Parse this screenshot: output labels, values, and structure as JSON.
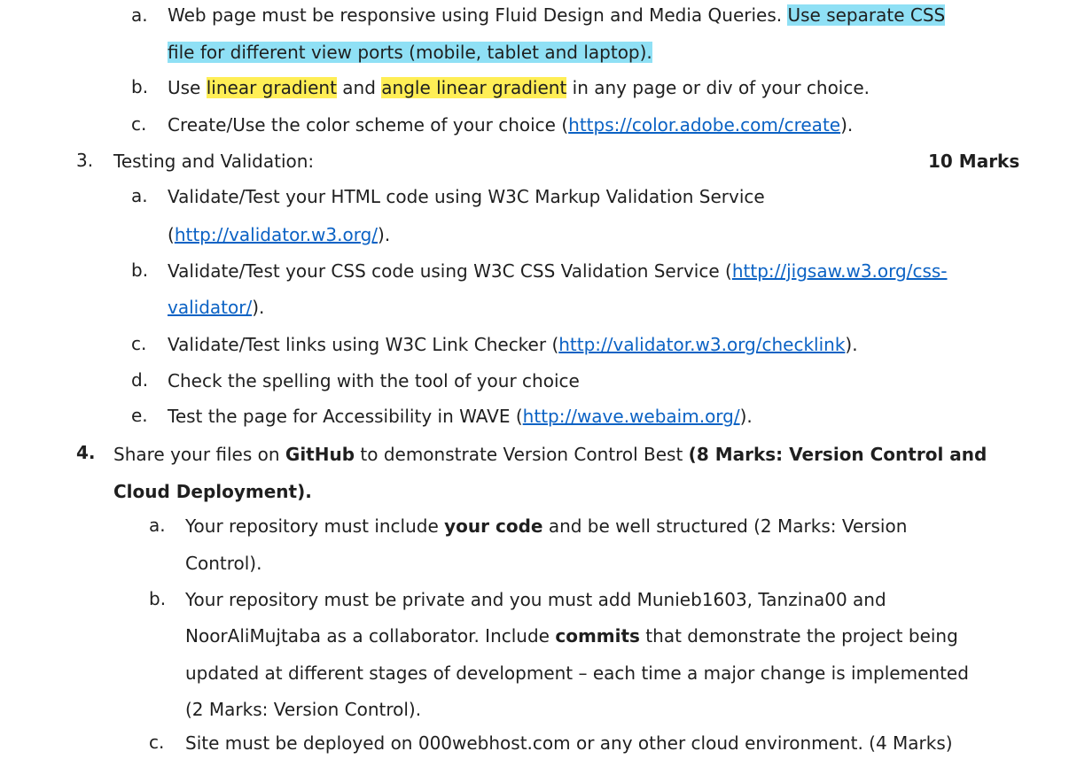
{
  "section2": {
    "a": {
      "label": "a.",
      "text1": "Web page must be responsive using Fluid Design and Media Queries. ",
      "highlight1": "Use separate CSS",
      "highlight2": "file for different view ports (mobile, tablet and laptop)."
    },
    "b": {
      "label": "b.",
      "text1": "Use ",
      "hl1": "linear gradient",
      "text2": " and ",
      "hl2": "angle linear gradient",
      "text3": " in any page or div of your choice."
    },
    "c": {
      "label": "c.",
      "text1": "Create/Use the color scheme of your choice (",
      "link": "https://color.adobe.com/create",
      "text2": ")."
    }
  },
  "section3": {
    "number": "3.",
    "title": "Testing and Validation:",
    "marks": "10 Marks",
    "a": {
      "label": "a.",
      "text1": "Validate/Test your HTML code using W3C Markup Validation Service",
      "open": "(",
      "link": "http://validator.w3.org/",
      "close": ")."
    },
    "b": {
      "label": "b.",
      "text1": "Validate/Test your CSS code using W3C CSS Validation Service (",
      "link1": "http://jigsaw.w3.org/css-",
      "link2": "validator/",
      "close": ")."
    },
    "c": {
      "label": "c.",
      "text1": "Validate/Test links using W3C Link Checker (",
      "link": "http://validator.w3.org/checklink",
      "close": ")."
    },
    "d": {
      "label": "d.",
      "text": "Check the spelling with the tool of your choice"
    },
    "e": {
      "label": "e.",
      "text1": "Test the page for Accessibility in WAVE (",
      "link": "http://wave.webaim.org/",
      "close": ")."
    }
  },
  "section4": {
    "number": "4.",
    "text1": "Share your files on ",
    "github": "GitHub",
    "text2": " to demonstrate Version Control Best ",
    "bold1": "(8 Marks: Version Control and",
    "bold2": "Cloud Deployment).",
    "a": {
      "label": "a.",
      "text1": "Your repository must include ",
      "bold": "your code",
      "text2": " and be well structured (2 Marks: Version",
      "line2": "Control)."
    },
    "b": {
      "label": "b.",
      "line1": "Your repository must be private and you must add Munieb1603, Tanzina00 and",
      "line2a": "NoorAliMujtaba as a collaborator.  Include ",
      "line2bold": "commits",
      "line2b": " that demonstrate the project being",
      "line3": "updated at different stages of development – each time a major change is implemented",
      "line4": "(2 Marks: Version Control)."
    },
    "c": {
      "label": "c.",
      "text": "Site must be deployed on 000webhost.com or any other cloud environment. (4 Marks)"
    }
  }
}
